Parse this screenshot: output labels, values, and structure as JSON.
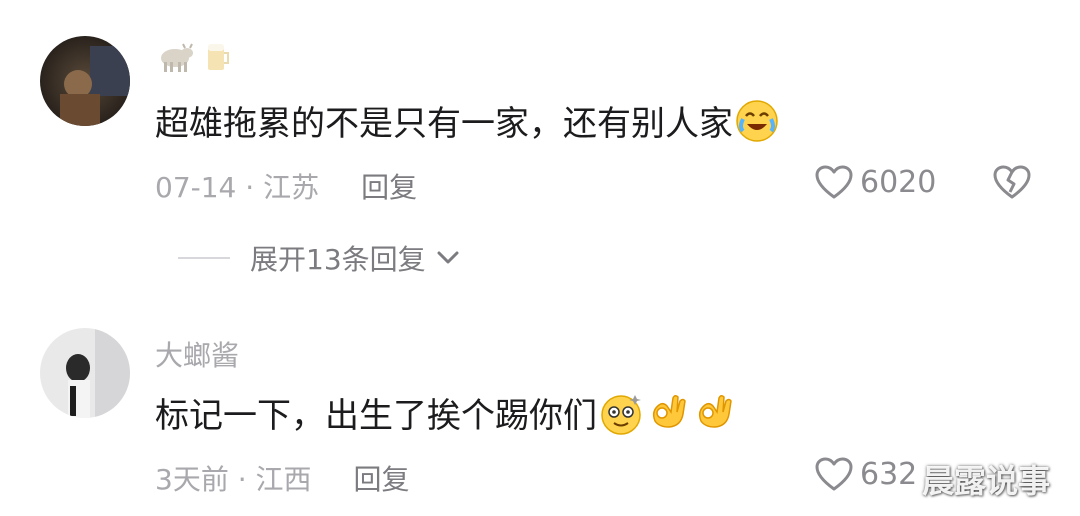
{
  "comments": [
    {
      "author": "",
      "text": "超雄拖累的不是只有一家，还有别人家",
      "date_location": "07-14 · 江苏",
      "reply_label": "回复",
      "likes": "6020",
      "expand_label": "展开13条回复",
      "emoji_names": [
        "cow-emoji-icon",
        "beer-emoji-icon",
        "laugh-cry-emoji-icon"
      ]
    },
    {
      "author": "大螂酱",
      "text": "标记一下，出生了挨个踢你们",
      "date_location": "3天前 · 江西",
      "reply_label": "回复",
      "likes": "632",
      "emoji_names": [
        "dizzy-face-emoji-icon",
        "ok-hand-emoji-icon",
        "ok-hand-emoji-icon"
      ]
    }
  ],
  "watermark": "晨露说事",
  "colors": {
    "meta": "#a8a8ad",
    "text": "#1c1c1e",
    "icon": "#8a8a8f"
  }
}
